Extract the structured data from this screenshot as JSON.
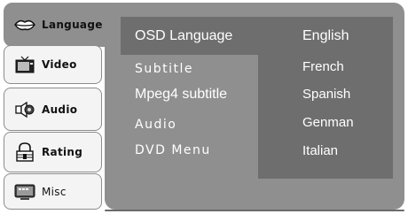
{
  "tabs": [
    {
      "label": "Language",
      "icon": "lips-icon"
    },
    {
      "label": "Video",
      "icon": "tv-icon"
    },
    {
      "label": "Audio",
      "icon": "speaker-icon"
    },
    {
      "label": "Rating",
      "icon": "lock-icon"
    },
    {
      "label": "Misc",
      "icon": "monitor-icon"
    }
  ],
  "menu": {
    "items": [
      "OSD Language",
      "Subtitle",
      "Mpeg4 subtitle",
      "Audio",
      "DVD Menu"
    ]
  },
  "options": {
    "selected": "English",
    "list": [
      "French",
      "Spanish",
      "Genman",
      "Italian"
    ]
  },
  "colors": {
    "panel": "#8f8f8f",
    "highlight": "#6e6e6e",
    "text": "#ffffff"
  }
}
